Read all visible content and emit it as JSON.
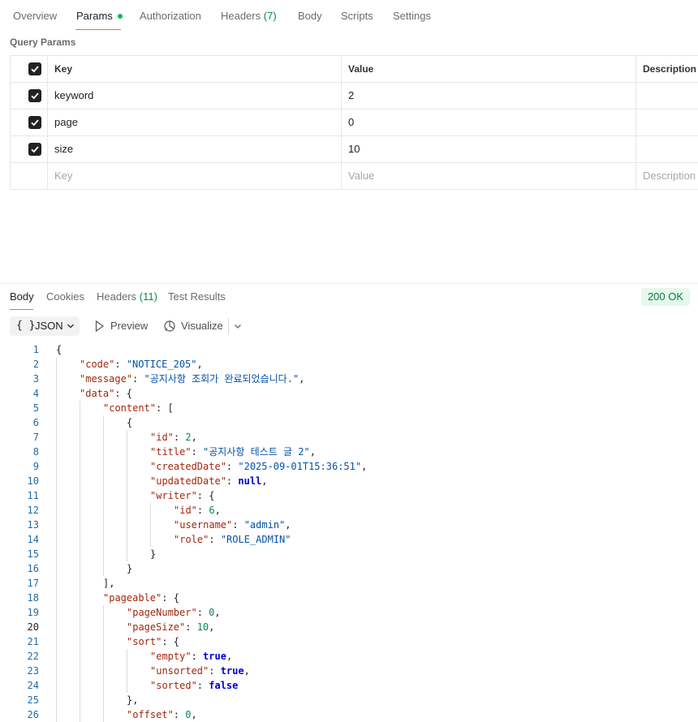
{
  "request_tabs": {
    "overview": "Overview",
    "params": "Params",
    "authorization": "Authorization",
    "headers_label": "Headers",
    "headers_count": "(7)",
    "body": "Body",
    "scripts": "Scripts",
    "settings": "Settings"
  },
  "params": {
    "section_title": "Query Params",
    "headers": {
      "key": "Key",
      "value": "Value",
      "description": "Description"
    },
    "rows": [
      {
        "checked": true,
        "key": "keyword",
        "value": "2"
      },
      {
        "checked": true,
        "key": "page",
        "value": "0"
      },
      {
        "checked": true,
        "key": "size",
        "value": "10"
      }
    ],
    "placeholders": {
      "key": "Key",
      "value": "Value",
      "description": "Description"
    }
  },
  "response": {
    "tabs": {
      "body": "Body",
      "cookies": "Cookies",
      "headers_label": "Headers",
      "headers_count": "(11)",
      "test_results": "Test Results"
    },
    "status": "200 OK",
    "toolbar": {
      "format_brace": "{ }",
      "format": "JSON",
      "preview": "Preview",
      "visualize": "Visualize"
    },
    "current_line": 20,
    "code_lines": [
      {
        "n": 1,
        "d": 0,
        "t": [
          [
            "p",
            "{"
          ]
        ]
      },
      {
        "n": 2,
        "d": 1,
        "t": [
          [
            "k",
            "\"code\""
          ],
          [
            "p",
            ": "
          ],
          [
            "s",
            "\"NOTICE_205\""
          ],
          [
            "p",
            ","
          ]
        ]
      },
      {
        "n": 3,
        "d": 1,
        "t": [
          [
            "k",
            "\"message\""
          ],
          [
            "p",
            ": "
          ],
          [
            "s",
            "\"공지사항 조회가 완료되었습니다.\""
          ],
          [
            "p",
            ","
          ]
        ]
      },
      {
        "n": 4,
        "d": 1,
        "t": [
          [
            "k",
            "\"data\""
          ],
          [
            "p",
            ": {"
          ]
        ]
      },
      {
        "n": 5,
        "d": 2,
        "t": [
          [
            "k",
            "\"content\""
          ],
          [
            "p",
            ": ["
          ]
        ]
      },
      {
        "n": 6,
        "d": 3,
        "t": [
          [
            "p",
            "{"
          ]
        ]
      },
      {
        "n": 7,
        "d": 4,
        "t": [
          [
            "k",
            "\"id\""
          ],
          [
            "p",
            ": "
          ],
          [
            "n",
            "2"
          ],
          [
            "p",
            ","
          ]
        ]
      },
      {
        "n": 8,
        "d": 4,
        "t": [
          [
            "k",
            "\"title\""
          ],
          [
            "p",
            ": "
          ],
          [
            "s",
            "\"공지사항 테스트 글 2\""
          ],
          [
            "p",
            ","
          ]
        ]
      },
      {
        "n": 9,
        "d": 4,
        "t": [
          [
            "k",
            "\"createdDate\""
          ],
          [
            "p",
            ": "
          ],
          [
            "s",
            "\"2025-09-01T15:36:51\""
          ],
          [
            "p",
            ","
          ]
        ]
      },
      {
        "n": 10,
        "d": 4,
        "t": [
          [
            "k",
            "\"updatedDate\""
          ],
          [
            "p",
            ": "
          ],
          [
            "b",
            "null"
          ],
          [
            "p",
            ","
          ]
        ]
      },
      {
        "n": 11,
        "d": 4,
        "t": [
          [
            "k",
            "\"writer\""
          ],
          [
            "p",
            ": {"
          ]
        ]
      },
      {
        "n": 12,
        "d": 5,
        "t": [
          [
            "k",
            "\"id\""
          ],
          [
            "p",
            ": "
          ],
          [
            "n",
            "6"
          ],
          [
            "p",
            ","
          ]
        ]
      },
      {
        "n": 13,
        "d": 5,
        "t": [
          [
            "k",
            "\"username\""
          ],
          [
            "p",
            ": "
          ],
          [
            "s",
            "\"admin\""
          ],
          [
            "p",
            ","
          ]
        ]
      },
      {
        "n": 14,
        "d": 5,
        "t": [
          [
            "k",
            "\"role\""
          ],
          [
            "p",
            ": "
          ],
          [
            "s",
            "\"ROLE_ADMIN\""
          ]
        ]
      },
      {
        "n": 15,
        "d": 4,
        "t": [
          [
            "p",
            "}"
          ]
        ]
      },
      {
        "n": 16,
        "d": 3,
        "t": [
          [
            "p",
            "}"
          ]
        ]
      },
      {
        "n": 17,
        "d": 2,
        "t": [
          [
            "p",
            "],"
          ]
        ]
      },
      {
        "n": 18,
        "d": 2,
        "t": [
          [
            "k",
            "\"pageable\""
          ],
          [
            "p",
            ": {"
          ]
        ]
      },
      {
        "n": 19,
        "d": 3,
        "t": [
          [
            "k",
            "\"pageNumber\""
          ],
          [
            "p",
            ": "
          ],
          [
            "n",
            "0"
          ],
          [
            "p",
            ","
          ]
        ]
      },
      {
        "n": 20,
        "d": 3,
        "t": [
          [
            "k",
            "\"pageSize\""
          ],
          [
            "p",
            ": "
          ],
          [
            "n",
            "10"
          ],
          [
            "p",
            ","
          ]
        ]
      },
      {
        "n": 21,
        "d": 3,
        "t": [
          [
            "k",
            "\"sort\""
          ],
          [
            "p",
            ": {"
          ]
        ]
      },
      {
        "n": 22,
        "d": 4,
        "t": [
          [
            "k",
            "\"empty\""
          ],
          [
            "p",
            ": "
          ],
          [
            "b",
            "true"
          ],
          [
            "p",
            ","
          ]
        ]
      },
      {
        "n": 23,
        "d": 4,
        "t": [
          [
            "k",
            "\"unsorted\""
          ],
          [
            "p",
            ": "
          ],
          [
            "b",
            "true"
          ],
          [
            "p",
            ","
          ]
        ]
      },
      {
        "n": 24,
        "d": 4,
        "t": [
          [
            "k",
            "\"sorted\""
          ],
          [
            "p",
            ": "
          ],
          [
            "b",
            "false"
          ]
        ]
      },
      {
        "n": 25,
        "d": 3,
        "t": [
          [
            "p",
            "},"
          ]
        ]
      },
      {
        "n": 26,
        "d": 3,
        "t": [
          [
            "k",
            "\"offset\""
          ],
          [
            "p",
            ": "
          ],
          [
            "n",
            "0"
          ],
          [
            "p",
            ","
          ]
        ]
      }
    ]
  },
  "colors": {
    "accent": "#e8742a",
    "status_ok_bg": "#e6f7ec",
    "status_ok_text": "#0a7a3a",
    "json_key": "#a1260d",
    "json_string": "#0451a5",
    "json_number": "#098658",
    "json_literal": "#0000cc"
  }
}
